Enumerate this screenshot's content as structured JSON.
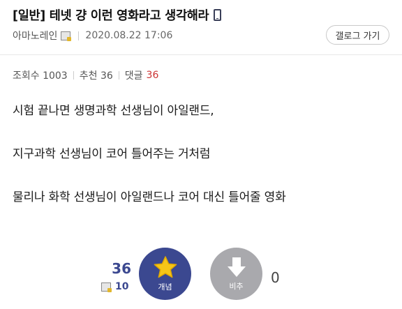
{
  "header": {
    "title": "[일반] 테넷 걍 이런 영화라고 생각해라",
    "author": "아마노레인",
    "date": "2020.08.22 17:06",
    "gallery_button": "갤로그 가기"
  },
  "stats": {
    "views_label": "조회수 1003",
    "recommend_label": "추천 36",
    "comments_label": "댓글",
    "comments_count": "36"
  },
  "post": {
    "lines": [
      "시험 끝나면 생명과학 선생님이 아일랜드,",
      "지구과학 선생님이 코어 틀어주는 거처럼",
      "물리나 화학 선생님이 아일랜드나 코어 대신 틀어줄 영화"
    ]
  },
  "vote": {
    "up_count": "36",
    "fixed_up_count": "10",
    "up_label": "개념",
    "down_label": "비추",
    "down_count": "0"
  },
  "colors": {
    "accent": "#3b4890",
    "down_button": "#a9a9ad",
    "star": "#f5c518",
    "comment_count": "#cc3333"
  }
}
